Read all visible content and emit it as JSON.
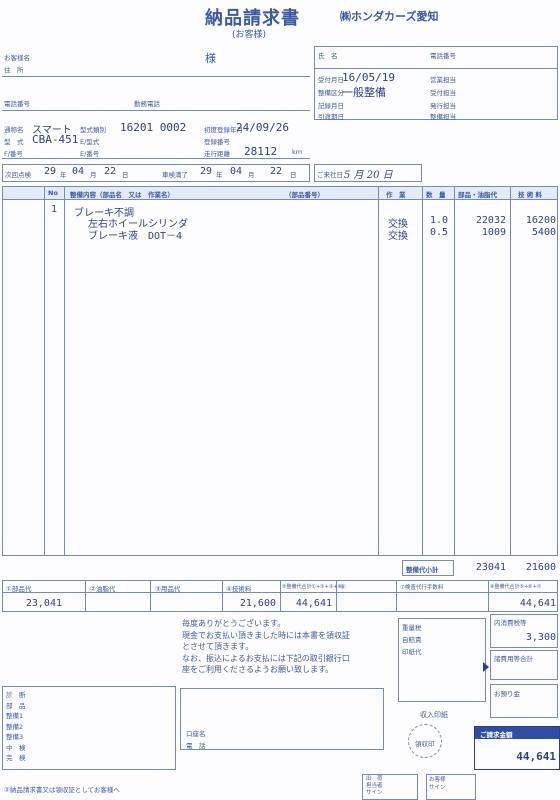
{
  "header": {
    "title": "納品請求書",
    "subtitle": "(お客様)",
    "company": "㈱ホンダカーズ愛知"
  },
  "customer": {
    "name_label": "お客様名",
    "address_label": "住　所",
    "sama": "様",
    "phone_label": "電話番号",
    "work_phone_label": "勤務電話"
  },
  "info_right": {
    "name_label": "氏　名",
    "phone_label": "電話番号",
    "received_date_label": "受付月日",
    "received_date": "16/05/19",
    "category_label": "整備区分",
    "category": "一般整備",
    "recorded_date_label": "記録月日",
    "delivery_label": "引渡期日",
    "sales_label": "営業担当",
    "reception_label": "受付担当",
    "issuer_label": "発行担当",
    "maintenance_label": "整備担当"
  },
  "vehicle": {
    "name_label": "通称名",
    "name": "スマート",
    "model_label": "型　式",
    "model": "CBA-451",
    "f_label": "F/番号",
    "type_class_label": "型式類別",
    "type_class": "16201 0002",
    "e_model_label": "E/型式",
    "e_number_label": "E/番号",
    "first_reg_label": "初度登録年月",
    "first_reg": "24/09/26",
    "reg_number_label": "登録番号",
    "mileage_label": "走行距離",
    "mileage": "28112",
    "mileage_unit": "km"
  },
  "inspection": {
    "next_label": "次回点検",
    "next_y": "29",
    "next_m": "04",
    "next_d": "22",
    "inspect_label": "車検満了",
    "inspect_y": "29",
    "inspect_m": "04",
    "inspect_d": "22",
    "unit_y": "年",
    "unit_m": "月",
    "unit_d": "日",
    "visit_label": "ご来社日",
    "visit": "5 月 20 日"
  },
  "table": {
    "headers": {
      "no": "No",
      "content": "整備内容（部品名　又は　作業名）",
      "part_no": "（部品番号）",
      "work": "作　業",
      "qty": "数　量",
      "parts_fee": "部品・油脂代",
      "tech_fee": "技 術 料"
    },
    "rows": [
      {
        "no": "1",
        "content": "ブレーキ不調",
        "work": "",
        "qty": "",
        "parts": "",
        "tech": ""
      },
      {
        "no": "",
        "content": "左右ホイールシリンダ",
        "work": "交換",
        "qty": "1.0",
        "parts": "22032",
        "tech": "16200"
      },
      {
        "no": "",
        "content": "ブレーキ液　DOT－4",
        "work": "交換",
        "qty": "0.5",
        "parts": "1009",
        "tech": "5400"
      }
    ],
    "subtotal_label": "整備代小計",
    "subtotal_parts": "23041",
    "subtotal_tech": "21600"
  },
  "totals": {
    "labels": [
      "①部品代",
      "②油脂代",
      "③用品代",
      "④技術料",
      "⑤整備代合計①+②+③+④",
      "⑥",
      "⑦検査代行手数料",
      "⑧整備代合計⑤+⑥+⑦"
    ],
    "values": [
      "23,041",
      "",
      "",
      "21,600",
      "44,641",
      "",
      "",
      "44,641"
    ]
  },
  "message": {
    "line1": "毎度ありがとうございます。",
    "line2": "現金でお支払い頂きました時には本書を領収証",
    "line3": "とさせて頂きます。",
    "line4": "なお、振込によるお支払には下記の取引銀行口",
    "line5": "座をご利用くださるようお願い致します。"
  },
  "bank": {
    "account_label": "口座名",
    "phone_label": "電　話"
  },
  "stamps": {
    "weight_tax_label": "重量税",
    "insurance_label": "自賠責",
    "stamp_label": "印紙代",
    "revenue_stamp": "収入印紙",
    "receipt_seal": "領収印"
  },
  "right_panel": {
    "tax_label": "内消費税等",
    "tax_value": "3,300",
    "misc_label": "諸費用等合計",
    "deposit_label": "お預り金",
    "bill_label": "ご請求金額",
    "bill_value": "44,641"
  },
  "staff": {
    "labels": [
      "診　断",
      "部　品",
      "整備1",
      "整備2",
      "整備3",
      "中　検",
      "完　検"
    ]
  },
  "footer": {
    "note": "②納品請求書又は領収証としてお客様へ",
    "signer_label": "出　荷\n担当者\nサイン",
    "customer_sign_label": "お客様\nサイン"
  }
}
